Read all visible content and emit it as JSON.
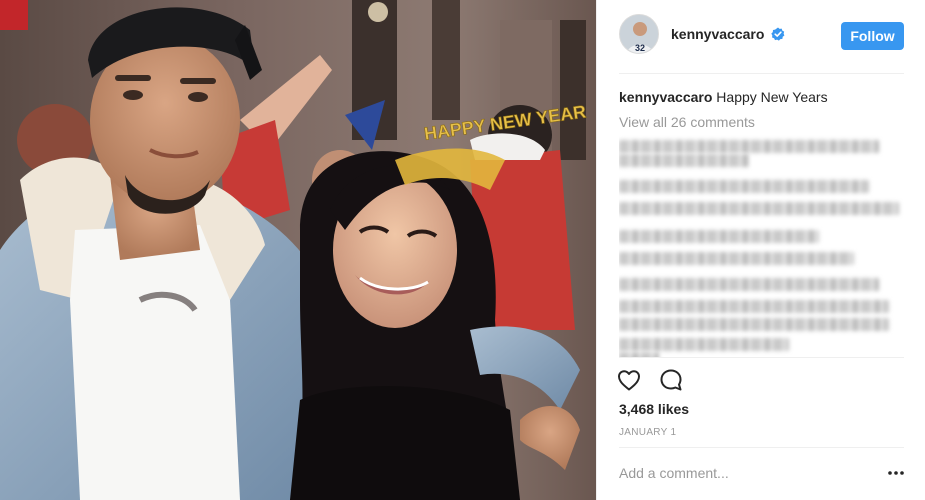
{
  "post": {
    "photo_alt": "",
    "crown_text": "HAPPY NEW YEAR"
  },
  "header": {
    "username": "kennyvaccaro",
    "verified": true,
    "follow_label": "Follow",
    "avatar_jersey_number": "32"
  },
  "caption": {
    "username": "kennyvaccaro",
    "text": "Happy New Years"
  },
  "comments": {
    "view_all_label": "View all 26 comments",
    "blurred": true
  },
  "actions": {
    "like_icon": "heart-outline-icon",
    "comment_icon": "speech-bubble-icon"
  },
  "likes": {
    "count_text": "3,468 likes"
  },
  "date": "JANUARY 1",
  "add_comment": {
    "placeholder": "Add a comment..."
  },
  "colors": {
    "accent": "#3897f0",
    "text": "#262626",
    "muted": "#999999",
    "divider": "#efefef"
  }
}
